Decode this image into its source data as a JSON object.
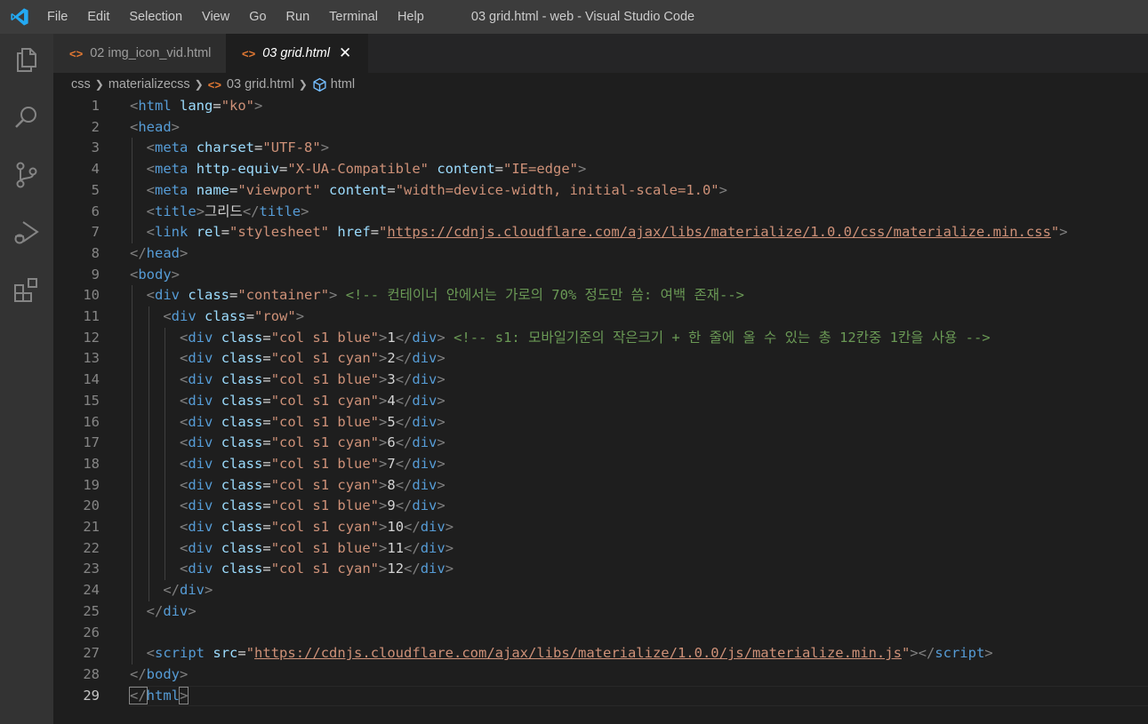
{
  "menu": [
    "File",
    "Edit",
    "Selection",
    "View",
    "Go",
    "Run",
    "Terminal",
    "Help"
  ],
  "window_title": "03 grid.html - web - Visual Studio Code",
  "tabs": [
    {
      "label": "02 img_icon_vid.html",
      "active": false
    },
    {
      "label": "03 grid.html",
      "active": true
    }
  ],
  "breadcrumb": [
    "css",
    "materializecss",
    "03 grid.html",
    "html"
  ],
  "current_line": 29,
  "lines": [
    {
      "n": "1",
      "indent": 0,
      "tokens": [
        [
          "t",
          "<"
        ],
        [
          "n",
          "html"
        ],
        [
          "x",
          " "
        ],
        [
          "a",
          "lang"
        ],
        [
          "x",
          "="
        ],
        [
          "s",
          "\"ko\""
        ],
        [
          "t",
          ">"
        ]
      ]
    },
    {
      "n": "2",
      "indent": 0,
      "tokens": [
        [
          "t",
          "<"
        ],
        [
          "n",
          "head"
        ],
        [
          "t",
          ">"
        ]
      ]
    },
    {
      "n": "3",
      "indent": 2,
      "tokens": [
        [
          "t",
          "<"
        ],
        [
          "n",
          "meta"
        ],
        [
          "x",
          " "
        ],
        [
          "a",
          "charset"
        ],
        [
          "x",
          "="
        ],
        [
          "s",
          "\"UTF-8\""
        ],
        [
          "t",
          ">"
        ]
      ]
    },
    {
      "n": "4",
      "indent": 2,
      "tokens": [
        [
          "t",
          "<"
        ],
        [
          "n",
          "meta"
        ],
        [
          "x",
          " "
        ],
        [
          "a",
          "http-equiv"
        ],
        [
          "x",
          "="
        ],
        [
          "s",
          "\"X-UA-Compatible\""
        ],
        [
          "x",
          " "
        ],
        [
          "a",
          "content"
        ],
        [
          "x",
          "="
        ],
        [
          "s",
          "\"IE=edge\""
        ],
        [
          "t",
          ">"
        ]
      ]
    },
    {
      "n": "5",
      "indent": 2,
      "tokens": [
        [
          "t",
          "<"
        ],
        [
          "n",
          "meta"
        ],
        [
          "x",
          " "
        ],
        [
          "a",
          "name"
        ],
        [
          "x",
          "="
        ],
        [
          "s",
          "\"viewport\""
        ],
        [
          "x",
          " "
        ],
        [
          "a",
          "content"
        ],
        [
          "x",
          "="
        ],
        [
          "s",
          "\"width=device-width, initial-scale=1.0\""
        ],
        [
          "t",
          ">"
        ]
      ]
    },
    {
      "n": "6",
      "indent": 2,
      "tokens": [
        [
          "t",
          "<"
        ],
        [
          "n",
          "title"
        ],
        [
          "t",
          ">"
        ],
        [
          "x",
          "그리드"
        ],
        [
          "t",
          "</"
        ],
        [
          "n",
          "title"
        ],
        [
          "t",
          ">"
        ]
      ]
    },
    {
      "n": "7",
      "indent": 2,
      "tokens": [
        [
          "t",
          "<"
        ],
        [
          "n",
          "link"
        ],
        [
          "x",
          " "
        ],
        [
          "a",
          "rel"
        ],
        [
          "x",
          "="
        ],
        [
          "s",
          "\"stylesheet\""
        ],
        [
          "x",
          " "
        ],
        [
          "a",
          "href"
        ],
        [
          "x",
          "="
        ],
        [
          "s",
          "\""
        ],
        [
          "u",
          "https://cdnjs.cloudflare.com/ajax/libs/materialize/1.0.0/css/materialize.min.css"
        ],
        [
          "s",
          "\""
        ],
        [
          "t",
          ">"
        ]
      ]
    },
    {
      "n": "8",
      "indent": 0,
      "tokens": [
        [
          "t",
          "</"
        ],
        [
          "n",
          "head"
        ],
        [
          "t",
          ">"
        ]
      ]
    },
    {
      "n": "9",
      "indent": 0,
      "tokens": [
        [
          "t",
          "<"
        ],
        [
          "n",
          "body"
        ],
        [
          "t",
          ">"
        ]
      ]
    },
    {
      "n": "10",
      "indent": 2,
      "tokens": [
        [
          "t",
          "<"
        ],
        [
          "n",
          "div"
        ],
        [
          "x",
          " "
        ],
        [
          "a",
          "class"
        ],
        [
          "x",
          "="
        ],
        [
          "s",
          "\"container\""
        ],
        [
          "t",
          ">"
        ],
        [
          "x",
          " "
        ],
        [
          "c",
          "<!-- 컨테이너 안에서는 가로의 70% 정도만 씀: 여백 존재-->"
        ]
      ]
    },
    {
      "n": "11",
      "indent": 4,
      "tokens": [
        [
          "t",
          "<"
        ],
        [
          "n",
          "div"
        ],
        [
          "x",
          " "
        ],
        [
          "a",
          "class"
        ],
        [
          "x",
          "="
        ],
        [
          "s",
          "\"row\""
        ],
        [
          "t",
          ">"
        ]
      ]
    },
    {
      "n": "12",
      "indent": 6,
      "tokens": [
        [
          "t",
          "<"
        ],
        [
          "n",
          "div"
        ],
        [
          "x",
          " "
        ],
        [
          "a",
          "class"
        ],
        [
          "x",
          "="
        ],
        [
          "s",
          "\"col s1 blue\""
        ],
        [
          "t",
          ">"
        ],
        [
          "x",
          "1"
        ],
        [
          "t",
          "</"
        ],
        [
          "n",
          "div"
        ],
        [
          "t",
          ">"
        ],
        [
          "x",
          " "
        ],
        [
          "c",
          "<!-- s1: 모바일기준의 작은크기 + 한 줄에 올 수 있는 총 12칸중 1칸을 사용 -->"
        ]
      ]
    },
    {
      "n": "13",
      "indent": 6,
      "tokens": [
        [
          "t",
          "<"
        ],
        [
          "n",
          "div"
        ],
        [
          "x",
          " "
        ],
        [
          "a",
          "class"
        ],
        [
          "x",
          "="
        ],
        [
          "s",
          "\"col s1 cyan\""
        ],
        [
          "t",
          ">"
        ],
        [
          "x",
          "2"
        ],
        [
          "t",
          "</"
        ],
        [
          "n",
          "div"
        ],
        [
          "t",
          ">"
        ]
      ]
    },
    {
      "n": "14",
      "indent": 6,
      "tokens": [
        [
          "t",
          "<"
        ],
        [
          "n",
          "div"
        ],
        [
          "x",
          " "
        ],
        [
          "a",
          "class"
        ],
        [
          "x",
          "="
        ],
        [
          "s",
          "\"col s1 blue\""
        ],
        [
          "t",
          ">"
        ],
        [
          "x",
          "3"
        ],
        [
          "t",
          "</"
        ],
        [
          "n",
          "div"
        ],
        [
          "t",
          ">"
        ]
      ]
    },
    {
      "n": "15",
      "indent": 6,
      "tokens": [
        [
          "t",
          "<"
        ],
        [
          "n",
          "div"
        ],
        [
          "x",
          " "
        ],
        [
          "a",
          "class"
        ],
        [
          "x",
          "="
        ],
        [
          "s",
          "\"col s1 cyan\""
        ],
        [
          "t",
          ">"
        ],
        [
          "x",
          "4"
        ],
        [
          "t",
          "</"
        ],
        [
          "n",
          "div"
        ],
        [
          "t",
          ">"
        ]
      ]
    },
    {
      "n": "16",
      "indent": 6,
      "tokens": [
        [
          "t",
          "<"
        ],
        [
          "n",
          "div"
        ],
        [
          "x",
          " "
        ],
        [
          "a",
          "class"
        ],
        [
          "x",
          "="
        ],
        [
          "s",
          "\"col s1 blue\""
        ],
        [
          "t",
          ">"
        ],
        [
          "x",
          "5"
        ],
        [
          "t",
          "</"
        ],
        [
          "n",
          "div"
        ],
        [
          "t",
          ">"
        ]
      ]
    },
    {
      "n": "17",
      "indent": 6,
      "tokens": [
        [
          "t",
          "<"
        ],
        [
          "n",
          "div"
        ],
        [
          "x",
          " "
        ],
        [
          "a",
          "class"
        ],
        [
          "x",
          "="
        ],
        [
          "s",
          "\"col s1 cyan\""
        ],
        [
          "t",
          ">"
        ],
        [
          "x",
          "6"
        ],
        [
          "t",
          "</"
        ],
        [
          "n",
          "div"
        ],
        [
          "t",
          ">"
        ]
      ]
    },
    {
      "n": "18",
      "indent": 6,
      "tokens": [
        [
          "t",
          "<"
        ],
        [
          "n",
          "div"
        ],
        [
          "x",
          " "
        ],
        [
          "a",
          "class"
        ],
        [
          "x",
          "="
        ],
        [
          "s",
          "\"col s1 blue\""
        ],
        [
          "t",
          ">"
        ],
        [
          "x",
          "7"
        ],
        [
          "t",
          "</"
        ],
        [
          "n",
          "div"
        ],
        [
          "t",
          ">"
        ]
      ]
    },
    {
      "n": "19",
      "indent": 6,
      "tokens": [
        [
          "t",
          "<"
        ],
        [
          "n",
          "div"
        ],
        [
          "x",
          " "
        ],
        [
          "a",
          "class"
        ],
        [
          "x",
          "="
        ],
        [
          "s",
          "\"col s1 cyan\""
        ],
        [
          "t",
          ">"
        ],
        [
          "x",
          "8"
        ],
        [
          "t",
          "</"
        ],
        [
          "n",
          "div"
        ],
        [
          "t",
          ">"
        ]
      ]
    },
    {
      "n": "20",
      "indent": 6,
      "tokens": [
        [
          "t",
          "<"
        ],
        [
          "n",
          "div"
        ],
        [
          "x",
          " "
        ],
        [
          "a",
          "class"
        ],
        [
          "x",
          "="
        ],
        [
          "s",
          "\"col s1 blue\""
        ],
        [
          "t",
          ">"
        ],
        [
          "x",
          "9"
        ],
        [
          "t",
          "</"
        ],
        [
          "n",
          "div"
        ],
        [
          "t",
          ">"
        ]
      ]
    },
    {
      "n": "21",
      "indent": 6,
      "tokens": [
        [
          "t",
          "<"
        ],
        [
          "n",
          "div"
        ],
        [
          "x",
          " "
        ],
        [
          "a",
          "class"
        ],
        [
          "x",
          "="
        ],
        [
          "s",
          "\"col s1 cyan\""
        ],
        [
          "t",
          ">"
        ],
        [
          "x",
          "10"
        ],
        [
          "t",
          "</"
        ],
        [
          "n",
          "div"
        ],
        [
          "t",
          ">"
        ]
      ]
    },
    {
      "n": "22",
      "indent": 6,
      "tokens": [
        [
          "t",
          "<"
        ],
        [
          "n",
          "div"
        ],
        [
          "x",
          " "
        ],
        [
          "a",
          "class"
        ],
        [
          "x",
          "="
        ],
        [
          "s",
          "\"col s1 blue\""
        ],
        [
          "t",
          ">"
        ],
        [
          "x",
          "11"
        ],
        [
          "t",
          "</"
        ],
        [
          "n",
          "div"
        ],
        [
          "t",
          ">"
        ]
      ]
    },
    {
      "n": "23",
      "indent": 6,
      "tokens": [
        [
          "t",
          "<"
        ],
        [
          "n",
          "div"
        ],
        [
          "x",
          " "
        ],
        [
          "a",
          "class"
        ],
        [
          "x",
          "="
        ],
        [
          "s",
          "\"col s1 cyan\""
        ],
        [
          "t",
          ">"
        ],
        [
          "x",
          "12"
        ],
        [
          "t",
          "</"
        ],
        [
          "n",
          "div"
        ],
        [
          "t",
          ">"
        ]
      ]
    },
    {
      "n": "24",
      "indent": 4,
      "tokens": [
        [
          "t",
          "</"
        ],
        [
          "n",
          "div"
        ],
        [
          "t",
          ">"
        ]
      ]
    },
    {
      "n": "25",
      "indent": 2,
      "tokens": [
        [
          "t",
          "</"
        ],
        [
          "n",
          "div"
        ],
        [
          "t",
          ">"
        ]
      ]
    },
    {
      "n": "26",
      "indent": 0,
      "tokens": []
    },
    {
      "n": "27",
      "indent": 2,
      "tokens": [
        [
          "t",
          "<"
        ],
        [
          "n",
          "script"
        ],
        [
          "x",
          " "
        ],
        [
          "a",
          "src"
        ],
        [
          "x",
          "="
        ],
        [
          "s",
          "\""
        ],
        [
          "u",
          "https://cdnjs.cloudflare.com/ajax/libs/materialize/1.0.0/js/materialize.min.js"
        ],
        [
          "s",
          "\""
        ],
        [
          "t",
          "></"
        ],
        [
          "n",
          "script"
        ],
        [
          "t",
          ">"
        ]
      ]
    },
    {
      "n": "28",
      "indent": 0,
      "tokens": [
        [
          "t",
          "</"
        ],
        [
          "n",
          "body"
        ],
        [
          "t",
          ">"
        ]
      ]
    },
    {
      "n": "29",
      "indent": 0,
      "tokens": [
        [
          "t",
          "</"
        ],
        [
          "n",
          "html"
        ],
        [
          "t",
          ">"
        ]
      ]
    }
  ]
}
